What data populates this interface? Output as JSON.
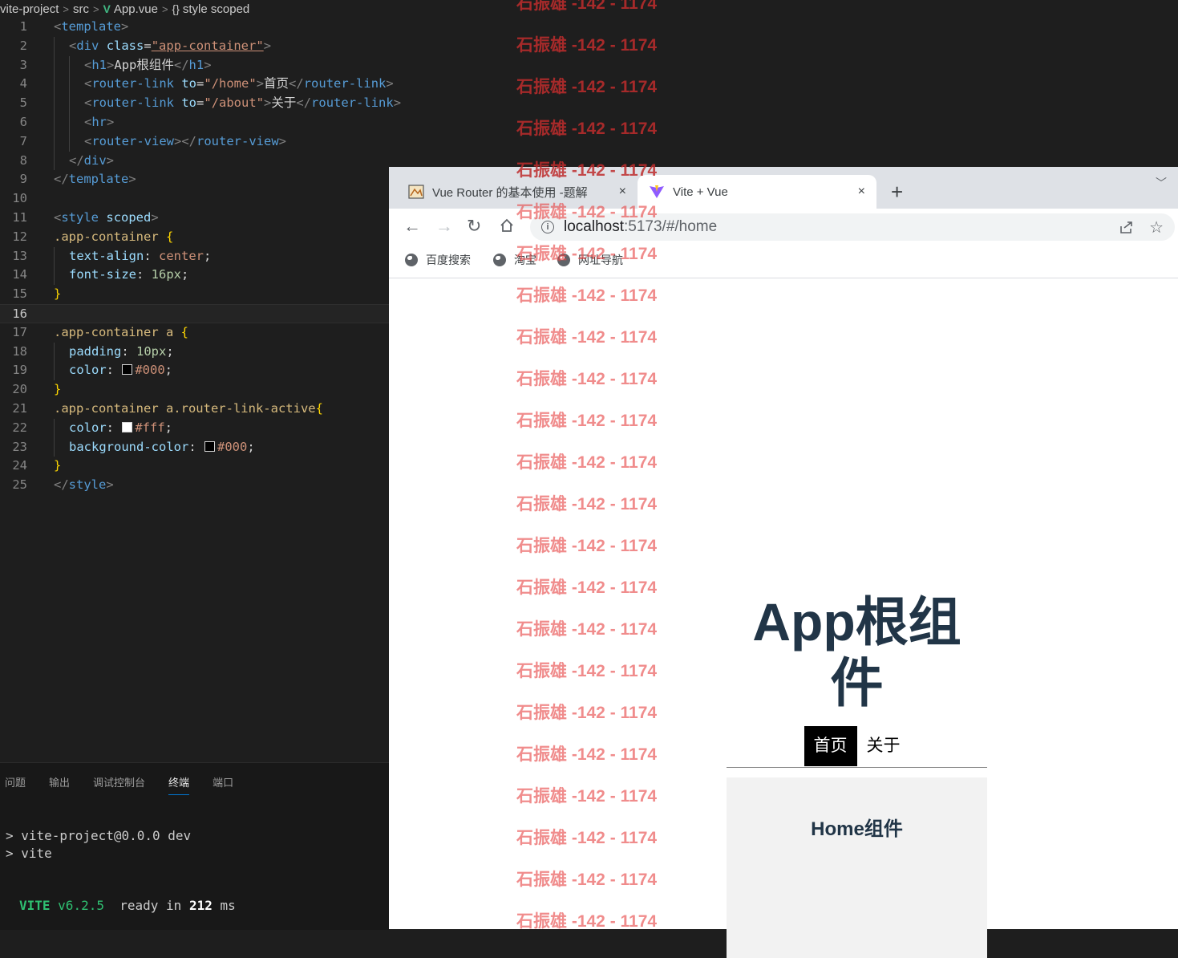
{
  "editor": {
    "breadcrumb": [
      "vite-project",
      "src",
      "App.vue",
      "style scoped"
    ],
    "lines": [
      {
        "n": "1"
      },
      {
        "n": "2"
      },
      {
        "n": "3"
      },
      {
        "n": "4"
      },
      {
        "n": "5"
      },
      {
        "n": "6"
      },
      {
        "n": "7"
      },
      {
        "n": "8"
      },
      {
        "n": "9"
      },
      {
        "n": "10"
      },
      {
        "n": "11"
      },
      {
        "n": "12"
      },
      {
        "n": "13"
      },
      {
        "n": "14"
      },
      {
        "n": "15"
      },
      {
        "n": "16"
      },
      {
        "n": "17"
      },
      {
        "n": "18"
      },
      {
        "n": "19"
      },
      {
        "n": "20"
      },
      {
        "n": "21"
      },
      {
        "n": "22"
      },
      {
        "n": "23"
      },
      {
        "n": "24"
      },
      {
        "n": "25"
      }
    ],
    "code": {
      "template_tag": "template",
      "div_tag": "div",
      "class_attr": "class",
      "class_val": "\"app-container\"",
      "h1_tag": "h1",
      "h1_text": "App根组件",
      "router_link_tag": "router-link",
      "to_attr": "to",
      "to_home": "\"/home\"",
      "home_text": "首页",
      "to_about": "\"/about\"",
      "about_text": "关于",
      "hr_tag": "hr",
      "router_view_tag": "router-view",
      "style_tag": "style",
      "scoped_attr": "scoped",
      "sel1": ".app-container",
      "prop_text_align": "text-align",
      "val_center": "center",
      "prop_font_size": "font-size",
      "val_16px": "16px",
      "sel2": ".app-container a",
      "prop_padding": "padding",
      "val_10px": "10px",
      "prop_color": "color",
      "val_000": "#000",
      "sel3": ".app-container a.router-link-active",
      "val_fff": "#fff",
      "prop_bg": "background-color",
      "colors": {
        "black": "#000000",
        "white": "#ffffff"
      }
    }
  },
  "panel": {
    "tabs": [
      "问题",
      "输出",
      "调试控制台",
      "终端",
      "端口"
    ],
    "active_tab": "终端",
    "terminal_lines": [
      "> vite-project@0.0.0 dev",
      "> vite"
    ],
    "vite_name": "VITE",
    "vite_version": "v6.2.5",
    "ready_text": "ready in",
    "ready_ms": "212",
    "ms_unit": "ms"
  },
  "browser": {
    "tabs": [
      {
        "title": "Vue Router 的基本使用 -题解",
        "close": "×"
      },
      {
        "title": "Vite + Vue",
        "close": "×"
      }
    ],
    "new_tab": "+",
    "tab_menu": "﹀",
    "url_host": "localhost",
    "url_rest": ":5173/#/home",
    "bookmarks": [
      "百度搜索",
      "淘宝",
      "网址导航"
    ],
    "page": {
      "title": "App根组件",
      "links": [
        "首页",
        "关于"
      ],
      "active_link": "首页",
      "home_component": "Home组件"
    }
  },
  "watermark": {
    "text": "石振雄 -142 - 1174",
    "count": 23,
    "color": "#e64646"
  }
}
